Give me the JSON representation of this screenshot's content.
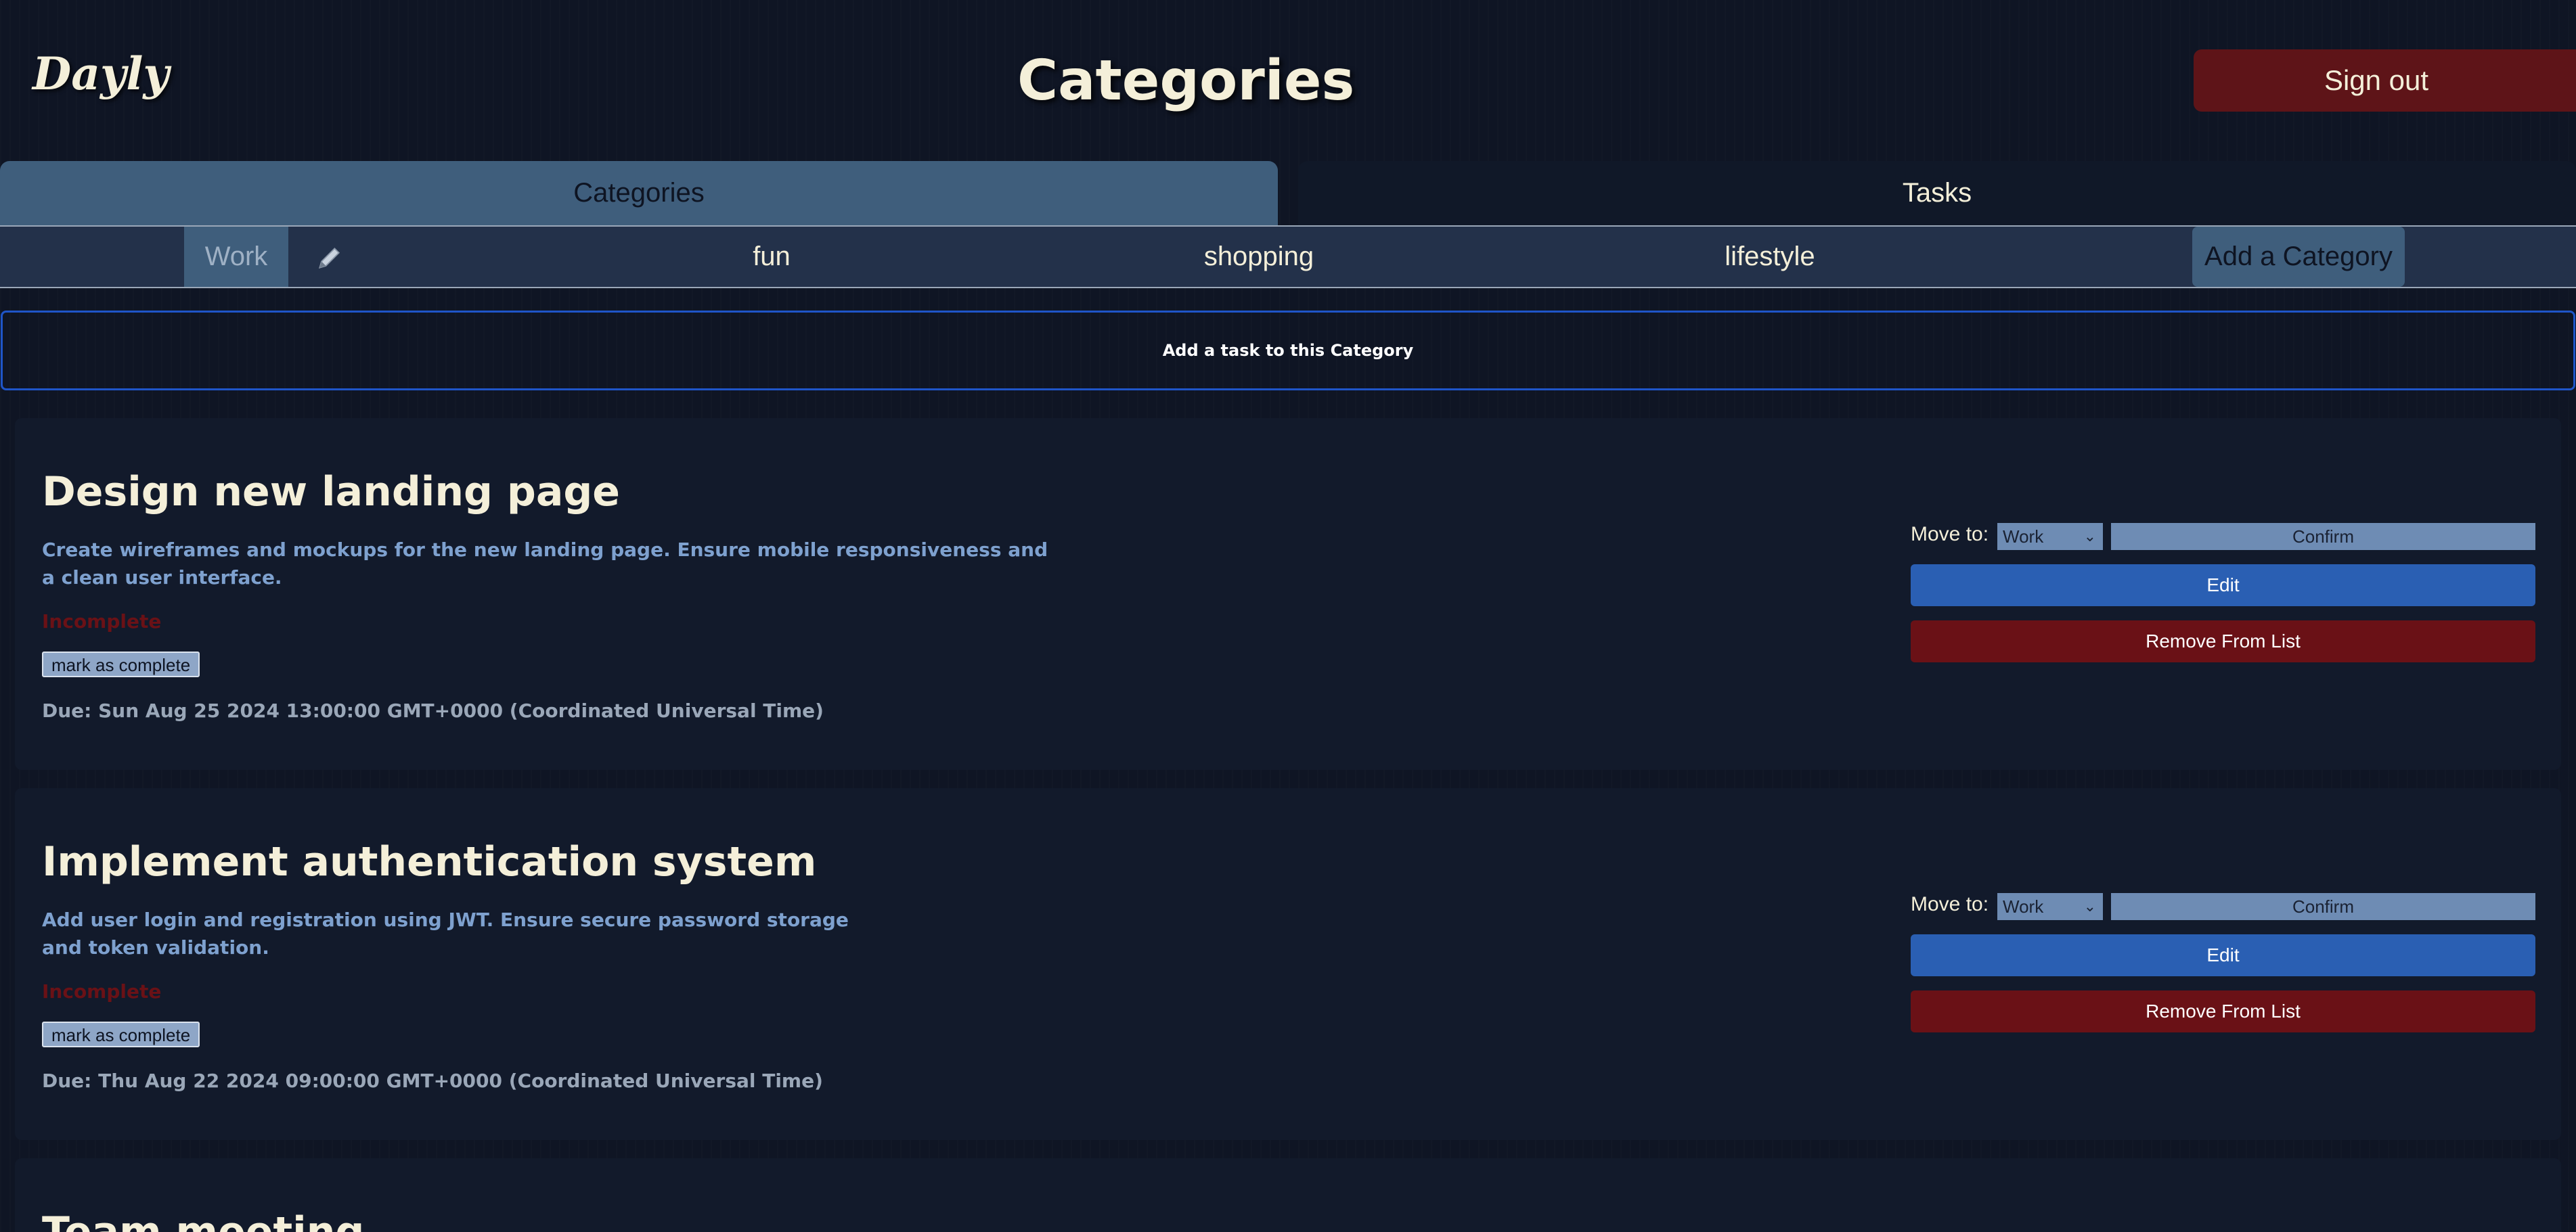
{
  "app": {
    "logo": "Dayly",
    "page_title": "Categories",
    "signout_label": "Sign out"
  },
  "tabs": [
    {
      "label": "Categories",
      "active": true
    },
    {
      "label": "Tasks",
      "active": false
    }
  ],
  "categories": {
    "items": [
      "Work",
      "fun",
      "shopping",
      "lifestyle"
    ],
    "selected": "Work",
    "edit_icon": "pencil-icon",
    "add_label": "Add a Category"
  },
  "add_task_label": "Add a task to this Category",
  "tasks": [
    {
      "title": "Design new landing page",
      "description": "Create wireframes and mockups for the new landing page. Ensure mobile responsiveness and a clean user interface.",
      "status": "Incomplete",
      "mark_label": "mark as complete",
      "due": "Due: Sun Aug 25 2024 13:00:00 GMT+0000 (Coordinated Universal Time)",
      "move_label": "Move to:",
      "move_value": "Work",
      "confirm_label": "Confirm",
      "edit_label": "Edit",
      "remove_label": "Remove From List"
    },
    {
      "title": "Implement authentication system",
      "description": "Add user login and registration using JWT. Ensure secure password storage and token validation.",
      "status": "Incomplete",
      "mark_label": "mark as complete",
      "due": "Due: Thu Aug 22 2024 09:00:00 GMT+0000 (Coordinated Universal Time)",
      "move_label": "Move to:",
      "move_value": "Work",
      "confirm_label": "Confirm",
      "edit_label": "Edit",
      "remove_label": "Remove From List"
    },
    {
      "title": "Team meeting"
    }
  ],
  "colors": {
    "background": "#0f1524",
    "accent_blue": "#2a5fb3",
    "danger_red": "#6a1116",
    "tab_active": "#3f5e7c",
    "text_cream": "#f4efd9"
  }
}
